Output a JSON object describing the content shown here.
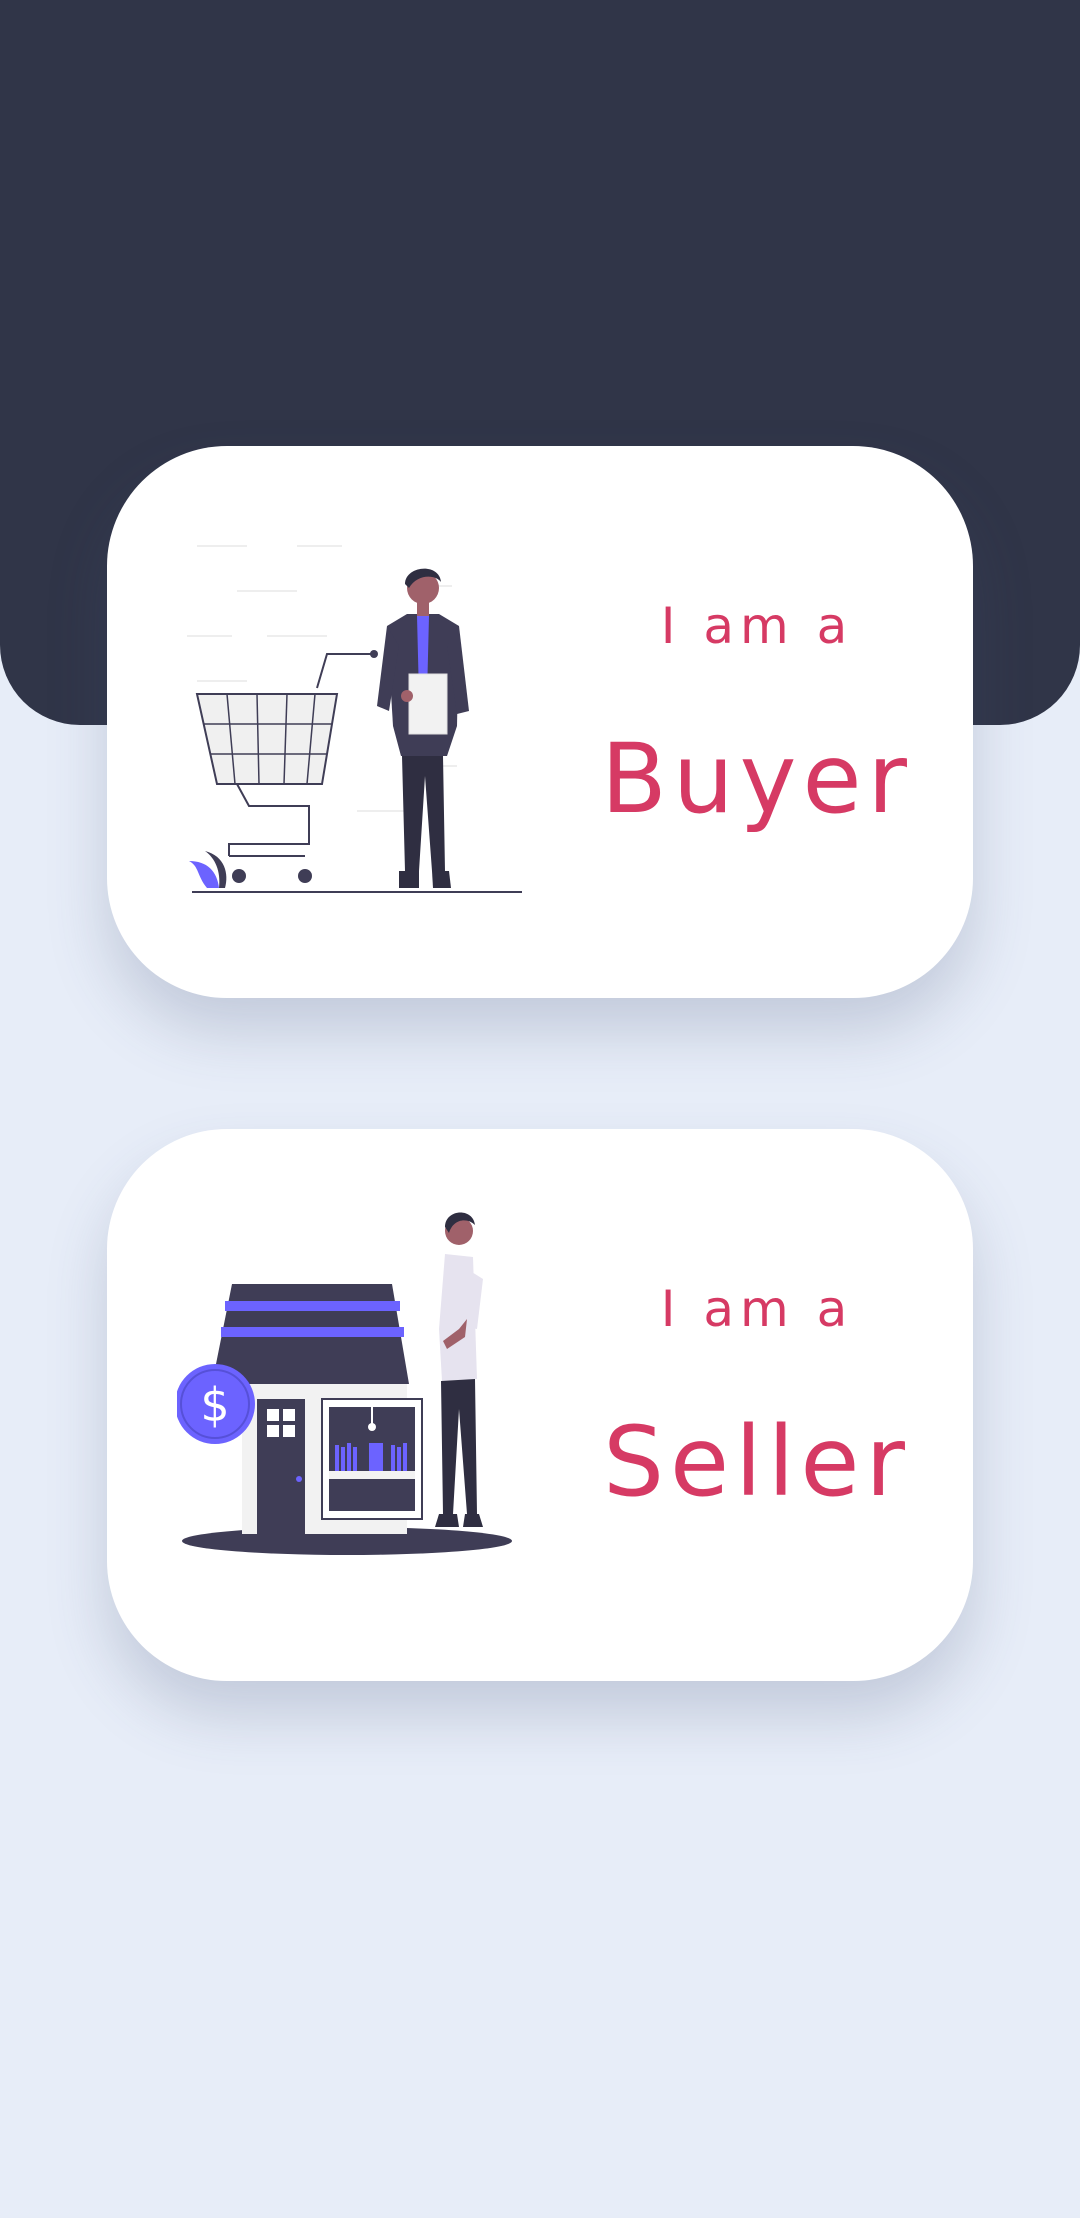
{
  "colors": {
    "header": "#303548",
    "background": "#e7edf8",
    "card": "#ffffff",
    "accent_text": "#d63a64",
    "illustration_purple": "#6c63ff",
    "illustration_dark": "#3f3d56"
  },
  "cards": [
    {
      "intro": "I am a",
      "role": "Buyer",
      "illustration": "shopping-cart-person-illustration"
    },
    {
      "intro": "I am a",
      "role": "Seller",
      "illustration": "storefront-person-illustration"
    }
  ],
  "icons": {
    "dollar_symbol": "$"
  }
}
